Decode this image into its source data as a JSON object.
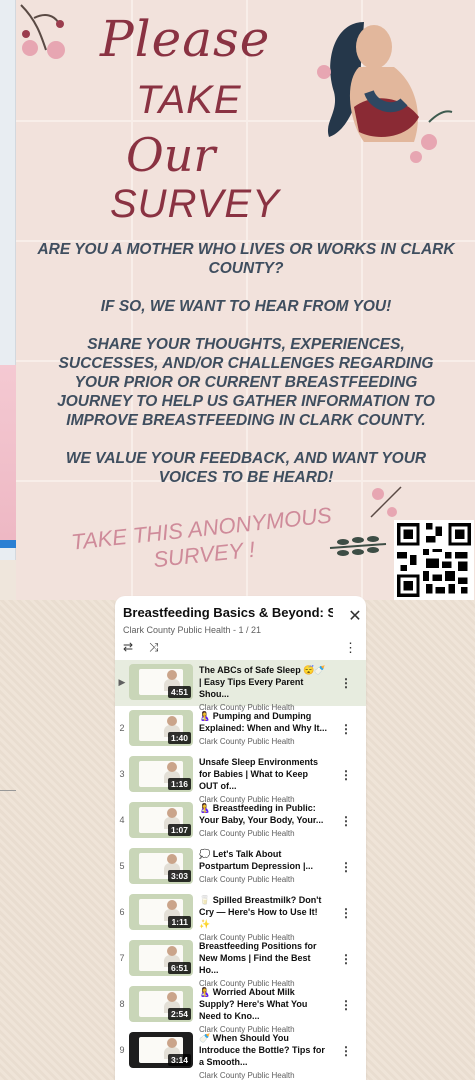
{
  "poster": {
    "please": "Please",
    "take": "TAKE",
    "our": "Our",
    "survey": "SURVEY",
    "paragraphs": [
      "ARE YOU A MOTHER WHO LIVES OR WORKS IN CLARK COUNTY?",
      "IF SO, WE WANT TO HEAR FROM YOU!",
      "SHARE YOUR THOUGHTS, EXPERIENCES, SUCCESSES, AND/OR CHALLENGES REGARDING YOUR PRIOR OR CURRENT BREASTFEEDING JOURNEY TO HELP US GATHER INFORMATION TO IMPROVE BREASTFEEDING IN CLARK COUNTY.",
      "WE VALUE YOUR FEEDBACK, AND WANT YOUR VOICES TO BE HEARD!"
    ],
    "anon_line1": "TAKE THIS ANONYMOUS",
    "anon_line2": "SURVEY !"
  },
  "playlist": {
    "title": "Breastfeeding Basics & Beyond: Sup...",
    "subtitle": "Clark County Public Health - 1 / 21",
    "items": [
      {
        "index": "▶",
        "title": "The ABCs of Safe Sleep 😴🍼 | Easy Tips Every Parent Shou...",
        "channel": "Clark County Public Health",
        "duration": "4:51",
        "active": true,
        "progress": 0.0
      },
      {
        "index": "2",
        "title": "🤱 Pumping and Dumping Explained: When and Why It...",
        "channel": "Clark County Public Health",
        "duration": "1:40",
        "active": false,
        "progress": 0.0
      },
      {
        "index": "3",
        "title": "Unsafe Sleep Environments for Babies | What to Keep OUT of...",
        "channel": "Clark County Public Health",
        "duration": "1:16",
        "active": false,
        "progress": 0.0
      },
      {
        "index": "4",
        "title": "🤱 Breastfeeding in Public: Your Baby, Your Body, Your...",
        "channel": "Clark County Public Health",
        "duration": "1:07",
        "active": false,
        "progress": 0.0
      },
      {
        "index": "5",
        "title": "💭 Let's Talk About Postpartum Depression |...",
        "channel": "Clark County Public Health",
        "duration": "3:03",
        "active": false,
        "progress": 0.0
      },
      {
        "index": "6",
        "title": "🥛 Spilled Breastmilk? Don't Cry — Here's How to Use It! ✨",
        "channel": "Clark County Public Health",
        "duration": "1:11",
        "active": false,
        "progress": 0.0
      },
      {
        "index": "7",
        "title": "Breastfeeding Positions for New Moms | Find the Best Ho...",
        "channel": "Clark County Public Health",
        "duration": "6:51",
        "active": false,
        "progress": 0.0
      },
      {
        "index": "8",
        "title": "🤱 Worried About Milk Supply? Here's What You Need to Kno...",
        "channel": "Clark County Public Health",
        "duration": "2:54",
        "active": false,
        "progress": 0.0
      },
      {
        "index": "9",
        "title": "🍼 When Should You Introduce the Bottle? Tips for a Smooth...",
        "channel": "Clark County Public Health",
        "duration": "3:14",
        "active": false,
        "progress": 0.0,
        "dark": true
      }
    ]
  },
  "colors": {
    "poster_bg": "#f2e2dc",
    "title": "#8a3242",
    "body": "#3f4e5f",
    "anon": "#cf8b9a",
    "active_row": "#e7ecdf"
  }
}
